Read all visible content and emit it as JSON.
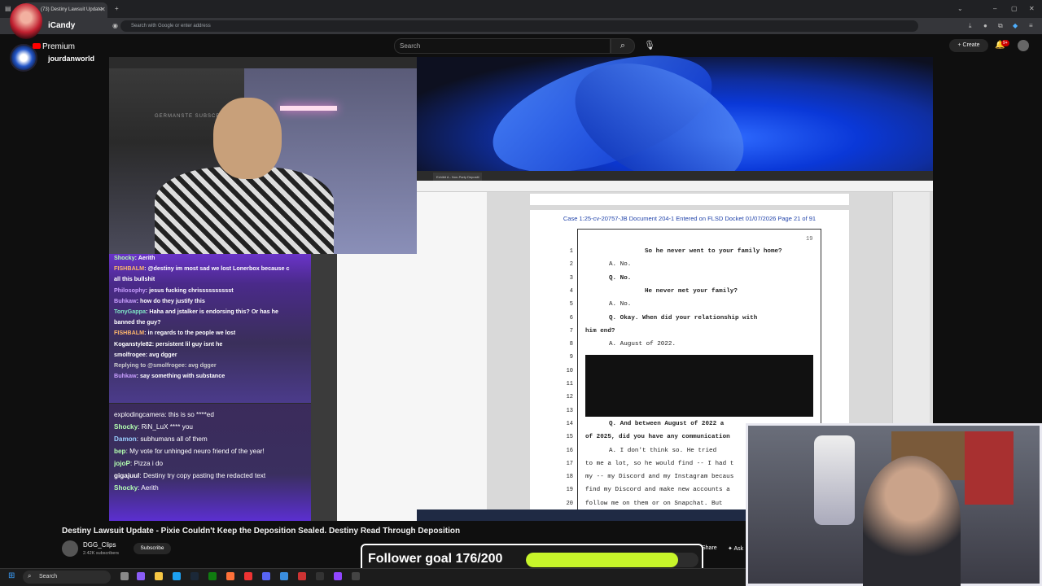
{
  "browser": {
    "tab_title": "(73) Destiny Lawsuit Update",
    "address_placeholder": "Search with Google or enter address"
  },
  "youtube": {
    "search_placeholder": "Search",
    "create_label": "Create",
    "notification_count": "9+",
    "premium_label": "Premium",
    "channel_name": "jourdanworld"
  },
  "overlay": {
    "top_name": "iCandy"
  },
  "document": {
    "tab_label": "Exhibit A - Non-Party Depositi",
    "header": "Case 1:25-cv-20757-JB   Document 204-1   Entered on FLSD Docket 01/07/2026   Page 21 of 91",
    "page_number": "19",
    "lines": [
      {
        "n": "1",
        "text": "So he never went to your family home?",
        "bold": true,
        "indent": "q"
      },
      {
        "n": "2",
        "text": "A.    No.",
        "bold": false,
        "indent": "a"
      },
      {
        "n": "3",
        "text": "Q.    No.",
        "bold": true,
        "indent": "a"
      },
      {
        "n": "4",
        "text": "He never met your family?",
        "bold": true,
        "indent": "q2"
      },
      {
        "n": "5",
        "text": "A.    No.",
        "bold": false,
        "indent": "a"
      },
      {
        "n": "6",
        "text": "Q.    Okay.  When did your relationship with",
        "bold": true,
        "indent": "a"
      },
      {
        "n": "7",
        "text": "him end?",
        "bold": true,
        "indent": "m"
      },
      {
        "n": "8",
        "text": "A.    August of 2022.",
        "bold": false,
        "indent": "a"
      },
      {
        "n": "9",
        "text": "",
        "bold": false,
        "indent": "a"
      },
      {
        "n": "10",
        "text": "",
        "bold": false,
        "indent": "a"
      },
      {
        "n": "11",
        "text": "",
        "bold": false,
        "indent": "a"
      },
      {
        "n": "12",
        "text": "",
        "bold": false,
        "indent": "a"
      },
      {
        "n": "13",
        "text": "",
        "bold": false,
        "indent": "a"
      },
      {
        "n": "14",
        "text": "Q.    And between August of 2022 a",
        "bold": true,
        "indent": "a"
      },
      {
        "n": "15",
        "text": "of 2025, did you have any communication",
        "bold": true,
        "indent": "m"
      },
      {
        "n": "16",
        "text": "A.    I don't think so.  He tried",
        "bold": false,
        "indent": "a"
      },
      {
        "n": "17",
        "text": "to me a lot, so he would find -- I had t",
        "bold": false,
        "indent": "m"
      },
      {
        "n": "18",
        "text": "my -- my Discord and my Instagram becaus",
        "bold": false,
        "indent": "m"
      },
      {
        "n": "19",
        "text": "find my Discord and make new accounts a",
        "bold": false,
        "indent": "m"
      },
      {
        "n": "20",
        "text": "follow me on them or on Snapchat.  But",
        "bold": false,
        "indent": "m"
      }
    ]
  },
  "chat_top": [
    {
      "user": "Shocky",
      "msg": "Aerith",
      "color": "#b3ffb0"
    },
    {
      "user": "FISHBALM",
      "msg": "@destiny im most sad we lost Lonerbox because c",
      "color": "#ffb86b"
    },
    {
      "user": "",
      "msg": "all this bullshit",
      "color": "#ffffff"
    },
    {
      "user": "Philosophy",
      "msg": "jesus fucking chrisssssssssst",
      "color": "#c9a0ff"
    },
    {
      "user": "Buhkaw",
      "msg": "how do they justify this",
      "color": "#c9a0ff"
    },
    {
      "user": "TonyGappa",
      "msg": "Haha and jstalker is endorsing this? Or has he",
      "color": "#7fe7c4"
    },
    {
      "user": "",
      "msg": "banned the guy?",
      "color": "#ffffff"
    },
    {
      "user": "FISHBALM",
      "msg": "in regards to the people we lost",
      "color": "#ffb86b"
    },
    {
      "user": "Koganstyle82",
      "msg": "persistent lil guy isnt he",
      "color": "#ffffff"
    },
    {
      "user": "smolfrogee",
      "msg": "avg dgger",
      "color": "#ffffff"
    },
    {
      "user": "",
      "msg": "Replying to @smolfrogee: avg dgger",
      "color": "#cccccc"
    },
    {
      "user": "Buhkaw",
      "msg": "say something with substance",
      "color": "#c9a0ff"
    }
  ],
  "chat_bottom": [
    {
      "user": "",
      "msg": "explodingcamera: this is so ****ed",
      "color": "#ffffff"
    },
    {
      "user": "Shocky",
      "msg": "RiN_LuX  **** you",
      "color": "#b3ffb0"
    },
    {
      "user": "Damon",
      "msg": "subhumans all of them",
      "color": "#9ad0ff"
    },
    {
      "user": "bep",
      "msg": "My vote for unhinged neuro friend of the year!",
      "color": "#b3ffb0"
    },
    {
      "user": "jojoP",
      "msg": "Pizza i do",
      "color": "#b3ffb0"
    },
    {
      "user": "gigajuul",
      "msg": "Destiny try copy pasting the redacted text",
      "color": "#ffffff"
    },
    {
      "user": "Shocky",
      "msg": "Aerith",
      "color": "#b3ffb0"
    }
  ],
  "cam_sign": "GERMANSTE SUBSCRI",
  "video": {
    "title": "Destiny Lawsuit Update - Pixie Couldn't Keep the Deposition Sealed. Destiny Read Through Deposition",
    "channel": "DGG_Clips",
    "subscribers": "2.42K subscribers",
    "subscribe_label": "Subscribe",
    "share_label": "Share",
    "ask_label": "Ask"
  },
  "follower_goal": {
    "label": "Follower goal 176/200",
    "current": 176,
    "target": 200,
    "fill_color": "#c7f52a"
  },
  "taskbar": {
    "search_label": "Search"
  }
}
